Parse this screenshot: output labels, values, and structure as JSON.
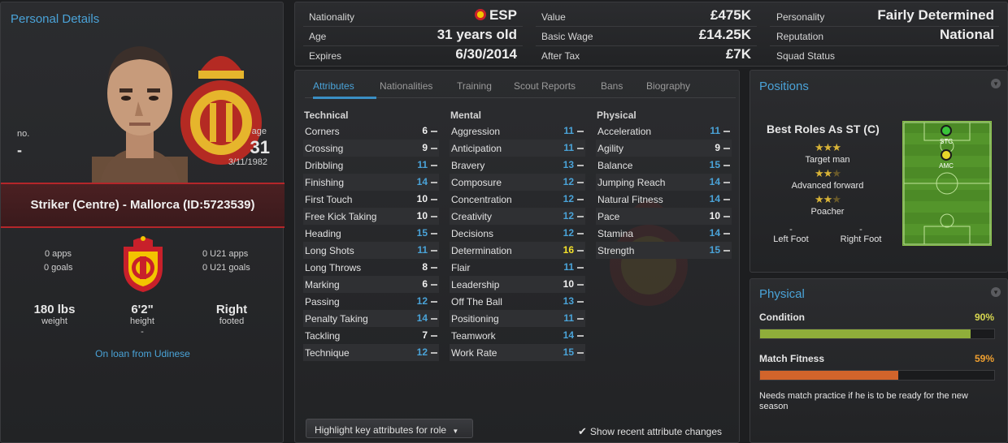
{
  "personal": {
    "title": "Personal Details",
    "squad_no_label": "no.",
    "squad_no": "-",
    "age_label": "age",
    "age": "31",
    "dob": "3/11/1982",
    "role_line": "Striker (Centre) - Mallorca (ID:5723539)",
    "apps": "0 apps",
    "goals": "0 goals",
    "u21_apps": "0 U21 apps",
    "u21_goals": "0 U21 goals",
    "weight": "180 lbs",
    "weight_label": "weight",
    "height": "6'2\"",
    "height_label": "height",
    "foot": "Right",
    "foot_label": "footed",
    "dash": "-",
    "loan": "On loan from Udinese"
  },
  "info": {
    "col1": [
      {
        "label": "Nationality",
        "value": "ESP"
      },
      {
        "label": "Age",
        "value": "31 years old"
      },
      {
        "label": "Expires",
        "value": "6/30/2014"
      }
    ],
    "col2": [
      {
        "label": "Value",
        "value": "£475K"
      },
      {
        "label": "Basic Wage",
        "value": "£14.25K"
      },
      {
        "label": "After Tax",
        "value": "£7K"
      }
    ],
    "col3": [
      {
        "label": "Personality",
        "value": "Fairly Determined"
      },
      {
        "label": "Reputation",
        "value": "National"
      },
      {
        "label": "Squad Status",
        "value": ""
      }
    ]
  },
  "tabs": [
    "Attributes",
    "Nationalities",
    "Training",
    "Scout Reports",
    "Bans",
    "Biography"
  ],
  "attributes": {
    "technical_title": "Technical",
    "mental_title": "Mental",
    "physical_title": "Physical",
    "technical": [
      {
        "name": "Corners",
        "value": "6"
      },
      {
        "name": "Crossing",
        "value": "9"
      },
      {
        "name": "Dribbling",
        "value": "11"
      },
      {
        "name": "Finishing",
        "value": "14"
      },
      {
        "name": "First Touch",
        "value": "10"
      },
      {
        "name": "Free Kick Taking",
        "value": "10"
      },
      {
        "name": "Heading",
        "value": "15"
      },
      {
        "name": "Long Shots",
        "value": "11"
      },
      {
        "name": "Long Throws",
        "value": "8"
      },
      {
        "name": "Marking",
        "value": "6"
      },
      {
        "name": "Passing",
        "value": "12"
      },
      {
        "name": "Penalty Taking",
        "value": "14"
      },
      {
        "name": "Tackling",
        "value": "7"
      },
      {
        "name": "Technique",
        "value": "12"
      }
    ],
    "mental": [
      {
        "name": "Aggression",
        "value": "11"
      },
      {
        "name": "Anticipation",
        "value": "11"
      },
      {
        "name": "Bravery",
        "value": "13"
      },
      {
        "name": "Composure",
        "value": "12"
      },
      {
        "name": "Concentration",
        "value": "12"
      },
      {
        "name": "Creativity",
        "value": "12"
      },
      {
        "name": "Decisions",
        "value": "12"
      },
      {
        "name": "Determination",
        "value": "16"
      },
      {
        "name": "Flair",
        "value": "11"
      },
      {
        "name": "Leadership",
        "value": "10"
      },
      {
        "name": "Off The Ball",
        "value": "13"
      },
      {
        "name": "Positioning",
        "value": "11"
      },
      {
        "name": "Teamwork",
        "value": "14"
      },
      {
        "name": "Work Rate",
        "value": "15"
      }
    ],
    "physical": [
      {
        "name": "Acceleration",
        "value": "11"
      },
      {
        "name": "Agility",
        "value": "9"
      },
      {
        "name": "Balance",
        "value": "15"
      },
      {
        "name": "Jumping Reach",
        "value": "14"
      },
      {
        "name": "Natural Fitness",
        "value": "14"
      },
      {
        "name": "Pace",
        "value": "10"
      },
      {
        "name": "Stamina",
        "value": "14"
      },
      {
        "name": "Strength",
        "value": "15"
      }
    ],
    "highlight_button": "Highlight key attributes for role",
    "show_recent": "Show recent attribute changes"
  },
  "positions": {
    "title": "Positions",
    "best_roles": "Best Roles As ST (C)",
    "roles": [
      {
        "name": "Target man",
        "stars": 3
      },
      {
        "name": "Advanced forward",
        "stars": 2.5
      },
      {
        "name": "Poacher",
        "stars": 2.5
      }
    ],
    "left_foot_value": "-",
    "right_foot_value": "-",
    "left_foot": "Left Foot",
    "right_foot": "Right Foot",
    "pitch_positions": [
      "STC",
      "AMC"
    ]
  },
  "physical_panel": {
    "title": "Physical",
    "condition_label": "Condition",
    "condition": "90%",
    "condition_fill": 0.9,
    "fitness_label": "Match Fitness",
    "fitness": "59%",
    "fitness_fill": 0.59,
    "note": "Needs match practice if he is to be ready for the new season"
  },
  "colors": {
    "accent": "#4aa3d8",
    "highlight": "#f5e22a",
    "condition_bar": "#8fae3a",
    "fitness_bar": "#d2642b",
    "fitness_text": "#f0a030"
  }
}
